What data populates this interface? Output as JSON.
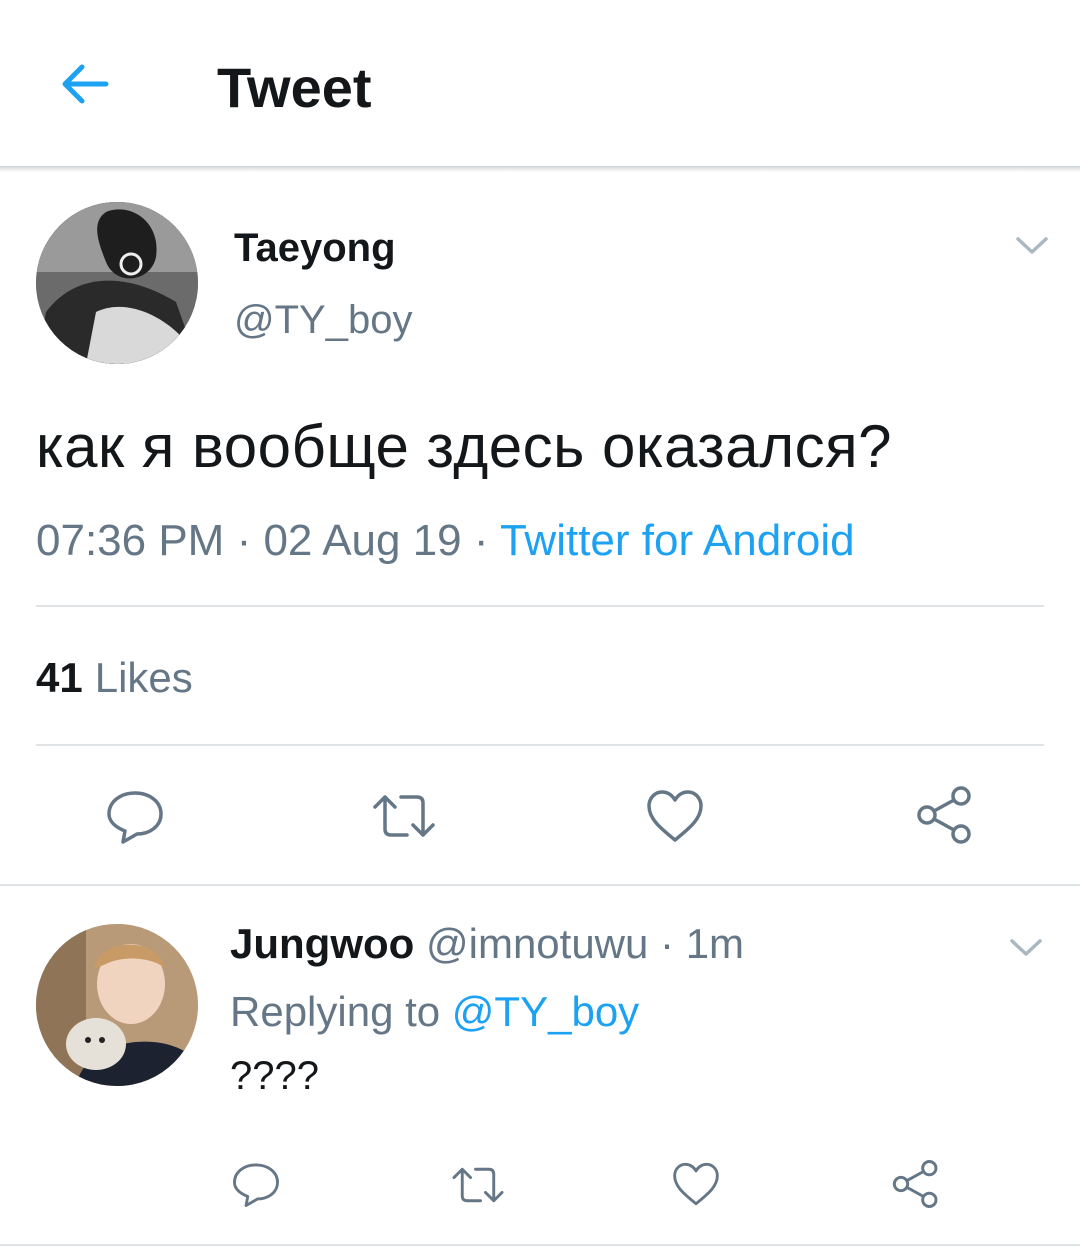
{
  "topbar": {
    "title": "Tweet",
    "back_icon": "arrow-left-icon"
  },
  "tweet": {
    "display_name": "Taeyong",
    "handle": "@TY_boy",
    "text": "как я вообще здесь оказался?",
    "time": "07:36 PM",
    "sep1": " · ",
    "date": "02 Aug 19",
    "sep2": " · ",
    "source": "Twitter for Android",
    "likes_count": "41",
    "likes_label": "Likes"
  },
  "reply": {
    "display_name": "Jungwoo",
    "handle": "@imnotuwu",
    "sep": " · ",
    "age": "1m",
    "replying_prefix": "Replying to ",
    "replying_to": "@TY_boy",
    "text": "????"
  },
  "colors": {
    "accent": "#1da1f2",
    "icon_gray": "#657786",
    "text": "#14171a",
    "divider": "#dfe3e6"
  }
}
